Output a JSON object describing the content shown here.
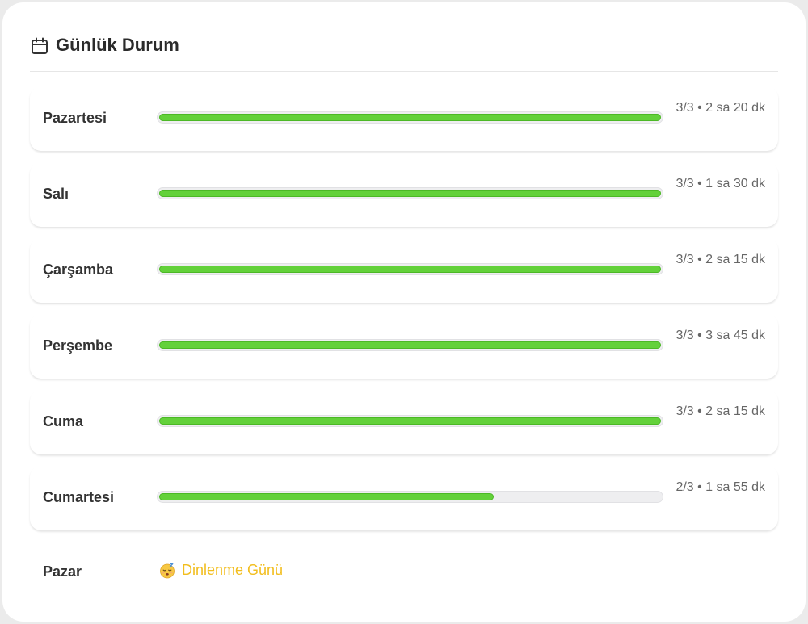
{
  "header": {
    "icon": "calendar-icon",
    "title": "Günlük Durum"
  },
  "days": [
    {
      "name": "Pazartesi",
      "stats": "3/3 • 2 sa 20 dk",
      "progress": 1.0
    },
    {
      "name": "Salı",
      "stats": "3/3 • 1 sa 30 dk",
      "progress": 1.0
    },
    {
      "name": "Çarşamba",
      "stats": "3/3 • 2 sa 15 dk",
      "progress": 1.0
    },
    {
      "name": "Perşembe",
      "stats": "3/3 • 3 sa 45 dk",
      "progress": 1.0
    },
    {
      "name": "Cuma",
      "stats": "3/3 • 2 sa 15 dk",
      "progress": 1.0
    },
    {
      "name": "Cumartesi",
      "stats": "2/3 • 1 sa 55 dk",
      "progress": 0.667
    }
  ],
  "rest_day": {
    "name": "Pazar",
    "icon": "sleeping-face-icon",
    "label": "Dinlenme Günü"
  },
  "colors": {
    "progress_fill": "#63d13a",
    "progress_track": "#eeeef0",
    "rest_label": "#f2be1f"
  }
}
